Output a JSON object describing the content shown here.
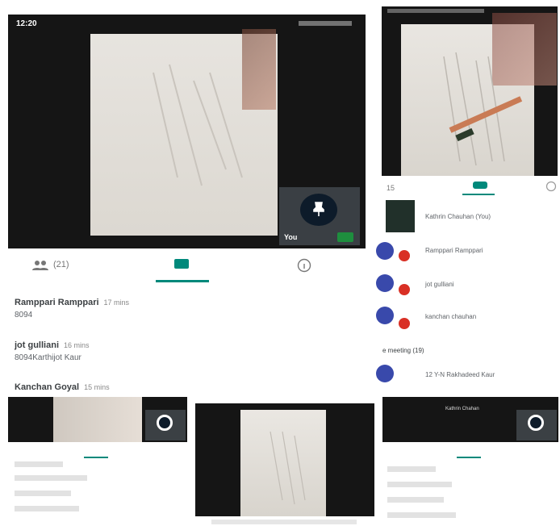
{
  "main": {
    "status_time": "12:20",
    "self_label": "You",
    "tabs": {
      "people": "(21)"
    },
    "messages": [
      {
        "sender": "Ramppari Ramppari",
        "time": "17 mins",
        "text": "8094"
      },
      {
        "sender": "jot gulliani",
        "time": "16 mins",
        "text": "8094Karthijot Kaur"
      },
      {
        "sender": "Kanchan Goyal",
        "time": "15 mins",
        "text": ""
      }
    ]
  },
  "right": {
    "tab_count": "15",
    "participants": [
      "Kathrin Chauhan (You)",
      "Ramppari Ramppari",
      "jot gulliani",
      "kanchan chauhan"
    ],
    "section_label": "e meeting (19)",
    "section_item": "12 Y-N Rakhadeed Kaur"
  },
  "thumbs": {
    "right_header": "Kathrin Chahan"
  },
  "colors": {
    "accent": "#00897b",
    "avatar": "#3949ab",
    "mic_off": "#d93025"
  }
}
